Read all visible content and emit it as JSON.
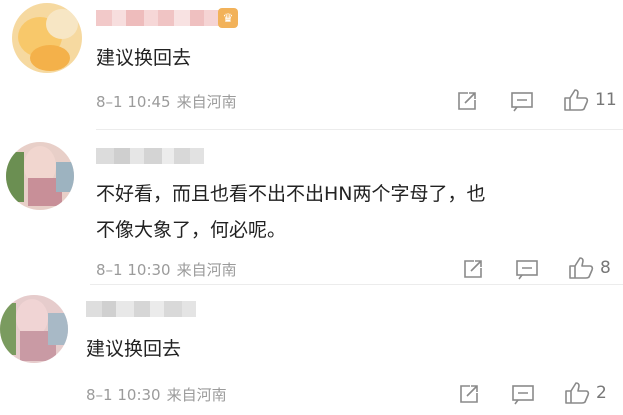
{
  "comments": [
    {
      "text": "建议换回去",
      "date": "8–1 10:45",
      "location": "来自河南",
      "likes": "11",
      "avatar_colors": [
        "#f3d89e",
        "#f7c66c",
        "#f5e2b8"
      ]
    },
    {
      "text_lines": [
        "不好看，而且也看不出不出HN两个字母了，也",
        "不像大象了，何必呢。"
      ],
      "date": "8–1 10:30",
      "location": "来自河南",
      "likes": "8",
      "avatar_colors": [
        "#e9c9c2",
        "#6b8f52",
        "#d7a3a3"
      ]
    },
    {
      "text": "建议换回去",
      "date": "8–1 10:30",
      "location": "来自河南",
      "likes": "2",
      "avatar_colors": [
        "#e7c4c4",
        "#7a9b5f",
        "#cfa0a8"
      ]
    }
  ],
  "icons": {
    "share": "share-icon",
    "comment": "comment-icon",
    "like": "thumbs-up-icon",
    "badge": "vip-badge-icon"
  },
  "colors": {
    "text": "#222222",
    "meta": "#9b9b9b",
    "icon": "#8a8a8a",
    "divider": "#ececec"
  }
}
